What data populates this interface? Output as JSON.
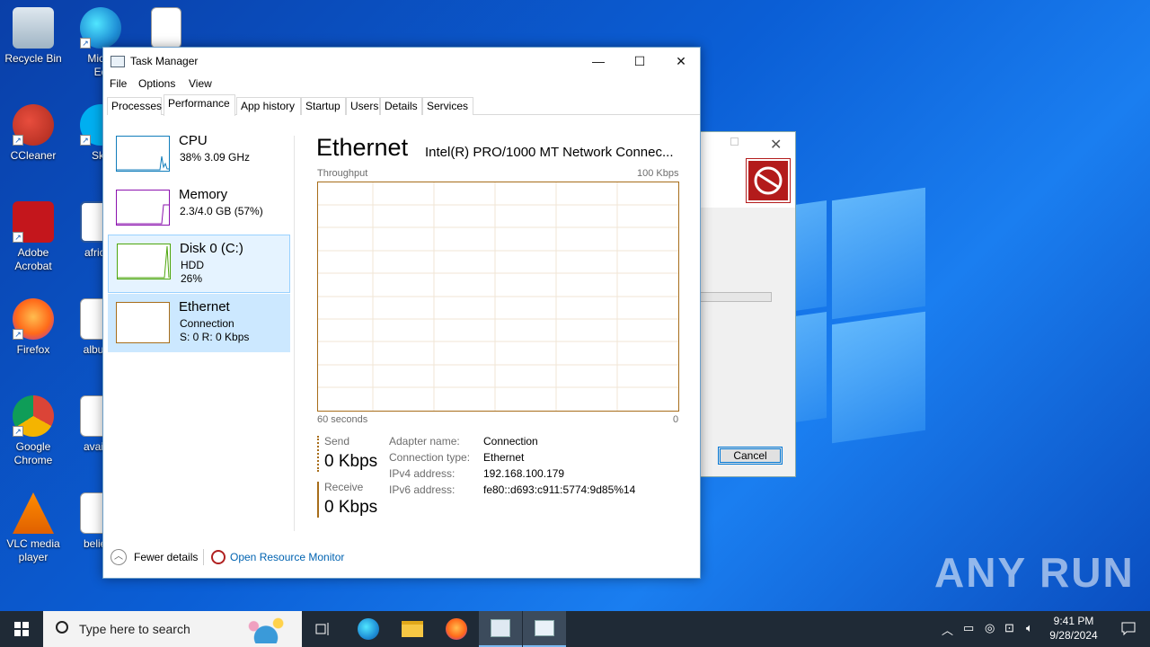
{
  "desktop": {
    "icons": [
      {
        "label": "Recycle Bin",
        "icon": "recycle-bin-icon"
      },
      {
        "label": "Micro\nEd",
        "icon": "edge-icon"
      },
      {
        "label": "CCleaner",
        "icon": "ccleaner-icon"
      },
      {
        "label": "Sky",
        "icon": "skype-icon"
      },
      {
        "label": "Adobe\nAcrobat",
        "icon": "acrobat-icon"
      },
      {
        "label": "africah",
        "icon": "word-doc-icon"
      },
      {
        "label": "Firefox",
        "icon": "firefox-icon"
      },
      {
        "label": "albumc",
        "icon": "image-file-icon"
      },
      {
        "label": "Google\nChrome",
        "icon": "chrome-icon"
      },
      {
        "label": "availab",
        "icon": "image-file-icon"
      },
      {
        "label": "VLC media\nplayer",
        "icon": "vlc-icon"
      },
      {
        "label": "believe",
        "icon": "image-file-icon"
      }
    ],
    "watermark": "ANY RUN"
  },
  "background_dialog": {
    "cancel_label": "Cancel"
  },
  "task_manager": {
    "title": "Task Manager",
    "menu": [
      "File",
      "Options",
      "View"
    ],
    "tabs": [
      "Processes",
      "Performance",
      "App history",
      "Startup",
      "Users",
      "Details",
      "Services"
    ],
    "active_tab": "Performance",
    "sidebar": [
      {
        "name": "CPU",
        "line2": "38%  3.09 GHz",
        "line3": "",
        "color": "#117dbb"
      },
      {
        "name": "Memory",
        "line2": "2.3/4.0 GB (57%)",
        "line3": "",
        "color": "#8b12ae"
      },
      {
        "name": "Disk 0 (C:)",
        "line2": "HDD",
        "line3": "26%",
        "color": "#4da60c"
      },
      {
        "name": "Ethernet",
        "line2": "Connection",
        "line3": "S: 0  R: 0 Kbps",
        "color": "#a76d1a"
      }
    ],
    "main": {
      "heading": "Ethernet",
      "adapter_full": "Intel(R) PRO/1000 MT Network Connec...",
      "throughput_label": "Throughput",
      "max_label": "100 Kbps",
      "time_label": "60 seconds",
      "zero_label": "0",
      "send_label": "Send",
      "send_value": "0 Kbps",
      "receive_label": "Receive",
      "receive_value": "0 Kbps",
      "details": [
        {
          "key": "Adapter name:",
          "value": "Connection"
        },
        {
          "key": "Connection type:",
          "value": "Ethernet"
        },
        {
          "key": "IPv4 address:",
          "value": "192.168.100.179"
        },
        {
          "key": "IPv6 address:",
          "value": "fe80::d693:c911:5774:9d85%14"
        }
      ]
    },
    "footer": {
      "fewer_details": "Fewer details",
      "resource_monitor": "Open Resource Monitor"
    }
  },
  "taskbar": {
    "search_placeholder": "Type here to search",
    "time": "9:41 PM",
    "date": "9/28/2024"
  }
}
